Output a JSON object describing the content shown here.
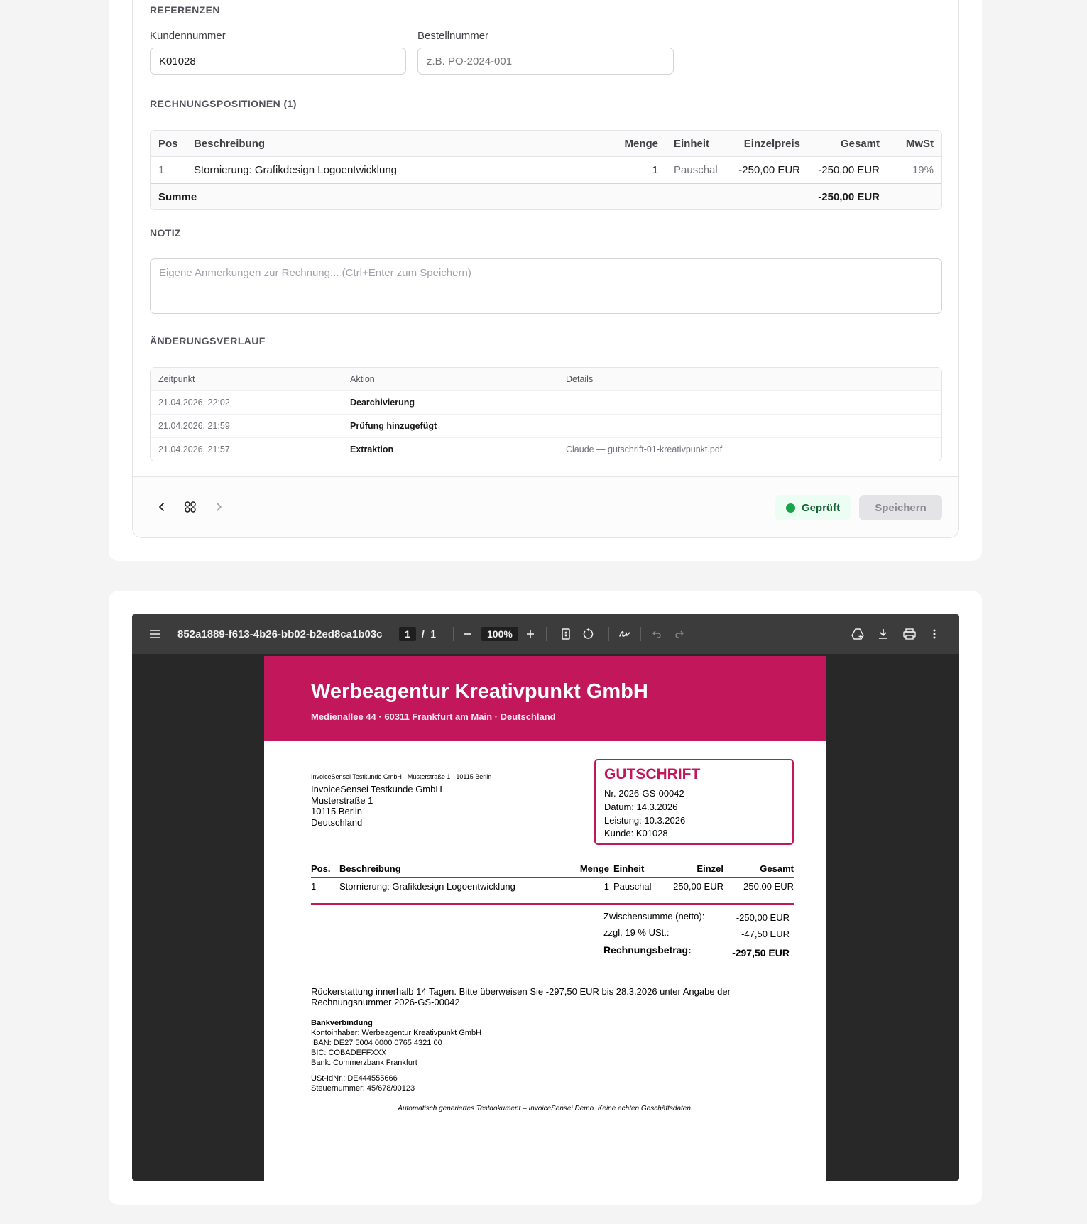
{
  "refs": {
    "section_title": "REFERENZEN",
    "customer_label": "Kundennummer",
    "customer_value": "K01028",
    "order_label": "Bestellnummer",
    "order_placeholder": "z.B. PO-2024-001"
  },
  "items": {
    "section_title": "RECHNUNGSPOSITIONEN (1)",
    "headers": {
      "pos": "Pos",
      "desc": "Beschreibung",
      "qty": "Menge",
      "unit": "Einheit",
      "price": "Einzelpreis",
      "total": "Gesamt",
      "vat": "MwSt"
    },
    "rows": [
      {
        "pos": "1",
        "desc": "Stornierung: Grafikdesign Logoentwicklung",
        "qty": "1",
        "unit": "Pauschal",
        "price": "-250,00 EUR",
        "total": "-250,00 EUR",
        "vat": "19%"
      }
    ],
    "sum_label": "Summe",
    "sum_value": "-250,00 EUR"
  },
  "note": {
    "section_title": "NOTIZ",
    "placeholder": "Eigene Anmerkungen zur Rechnung... (Ctrl+Enter zum Speichern)"
  },
  "history": {
    "section_title": "ÄNDERUNGSVERLAUF",
    "headers": {
      "time": "Zeitpunkt",
      "action": "Aktion",
      "details": "Details"
    },
    "rows": [
      {
        "time": "21.04.2026, 22:02",
        "action": "Dearchivierung",
        "details": ""
      },
      {
        "time": "21.04.2026, 21:59",
        "action": "Prüfung hinzugefügt",
        "details": ""
      },
      {
        "time": "21.04.2026, 21:57",
        "action": "Extraktion",
        "details": "Claude — gutschrift-01-kreativpunkt.pdf"
      }
    ]
  },
  "footer": {
    "status_label": "Geprüft",
    "save_label": "Speichern"
  },
  "viewer": {
    "filename": "852a1889-f613-4b26-bb02-b2ed8ca1b03c",
    "page_current": "1",
    "page_sep": "/",
    "page_total": "1",
    "zoom": "100%"
  },
  "pdf": {
    "company": "Werbeagentur Kreativpunkt GmbH",
    "company_addr": "Medienallee 44 · 60311 Frankfurt am Main · Deutschland",
    "sender_line": "InvoiceSensei Testkunde GmbH · Musterstraße 1 · 10115 Berlin",
    "recipient": [
      "InvoiceSensei Testkunde GmbH",
      "Musterstraße 1",
      "10115 Berlin",
      "Deutschland"
    ],
    "doc_type": "GUTSCHRIFT",
    "doc_lines": [
      "Nr. 2026-GS-00042",
      "Datum: 14.3.2026",
      "Leistung: 10.3.2026",
      "Kunde: K01028"
    ],
    "table_headers": {
      "pos": "Pos.",
      "desc": "Beschreibung",
      "qty": "Menge",
      "unit": "Einheit",
      "price": "Einzel",
      "total": "Gesamt"
    },
    "row": {
      "pos": "1",
      "desc": "Stornierung: Grafikdesign Logoentwicklung",
      "qty": "1",
      "unit": "Pauschal",
      "price": "-250,00 EUR",
      "total": "-250,00 EUR"
    },
    "subtotal_label": "Zwischensumme (netto):",
    "subtotal_value": "-250,00 EUR",
    "tax_label": "zzgl. 19 % USt.:",
    "tax_value": "-47,50 EUR",
    "grand_label": "Rechnungsbetrag:",
    "grand_value": "-297,50 EUR",
    "payment_text_1": "Rückerstattung innerhalb 14 Tagen. Bitte überweisen Sie -297,50 EUR bis 28.3.2026 unter Angabe der",
    "payment_text_2": "Rechnungsnummer 2026-GS-00042.",
    "bank_title": "Bankverbindung",
    "bank_lines": [
      "Kontoinhaber: Werbeagentur Kreativpunkt GmbH",
      "IBAN: DE27 5004 0000 0765 4321 00",
      "BIC: COBADEFFXXX",
      "Bank: Commerzbank Frankfurt"
    ],
    "tax_lines": [
      "USt-IdNr.: DE444555666",
      "Steuernummer: 45/678/90123"
    ],
    "disclaimer": "Automatisch generiertes Testdokument – InvoiceSensei Demo. Keine echten Geschäftsdaten."
  },
  "colors": {
    "brand": "#c2185b",
    "success": "#16a34a"
  }
}
